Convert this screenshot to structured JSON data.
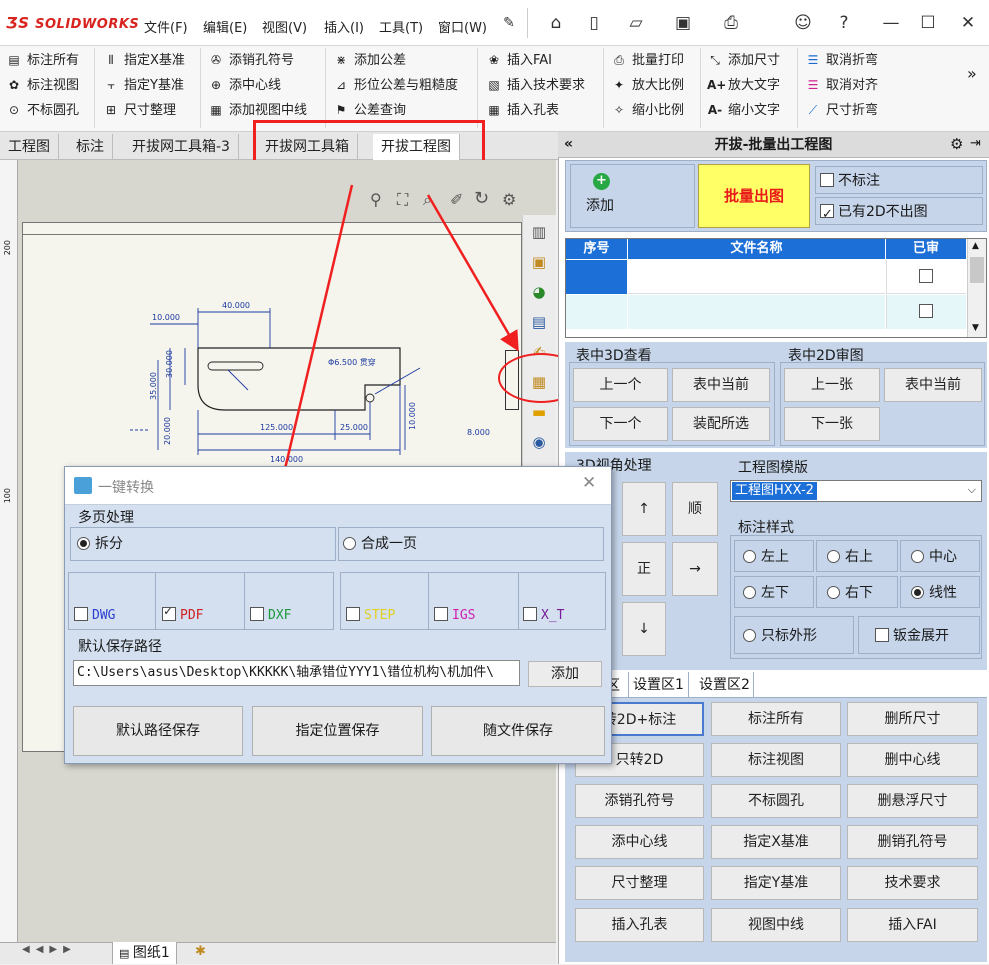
{
  "app": {
    "brand": "SOLIDWORKS"
  },
  "menu": [
    "文件(F)",
    "编辑(E)",
    "视图(V)",
    "插入(I)",
    "工具(T)",
    "窗口(W)"
  ],
  "ribbon": {
    "col1": [
      "标注所有",
      "标注视图",
      "不标圆孔"
    ],
    "col2": [
      "指定X基准",
      "指定Y基准",
      "尺寸整理"
    ],
    "col3": [
      "添销孔符号",
      "添中心线",
      "添加视图中线"
    ],
    "col4": [
      "添加公差",
      "形位公差与粗糙度",
      "公差查询"
    ],
    "col5": [
      "插入FAI",
      "插入技术要求",
      "插入孔表"
    ],
    "col6": [
      "批量打印",
      "放大比例",
      "缩小比例"
    ],
    "col7": [
      "添加尺寸",
      "放大文字",
      "缩小文字"
    ],
    "col8": [
      "取消折弯",
      "取消对齐",
      "尺寸折弯"
    ]
  },
  "tabs": [
    "工程图",
    "标注",
    "开拔网工具箱-3",
    "开拔网工具箱",
    "开拔工程图"
  ],
  "sheet_tab": "图纸1",
  "drawing": {
    "dims": [
      "40.000",
      "10.000",
      "35.000",
      "30.000",
      "20.000",
      "125.000",
      "25.000",
      "140.000",
      "Φ6.500 贯穿",
      "8.000",
      "10.000"
    ],
    "ruler": [
      "200",
      "100"
    ]
  },
  "panel": {
    "title": "开拔-批量出工程图",
    "add": "添加",
    "batch": "批量出图",
    "no_annotate": "不标注",
    "skip_2d": "已有2D不出图",
    "table_headers": [
      "序号",
      "文件名称",
      "已审"
    ],
    "view3d_title": "表中3D查看",
    "review2d_title": "表中2D审图",
    "prev": "上一个",
    "current": "表中当前",
    "next": "下一个",
    "assembly_sel": "装配所选",
    "prev_sheet": "上一张",
    "next_sheet": "下一张",
    "view_title": "3D视角处理",
    "arrows": [
      "↑",
      "顺",
      "正",
      "→",
      "↓"
    ],
    "template_title": "工程图模版",
    "template_value": "工程图HXX-2",
    "style_title": "标注样式",
    "styles": [
      "左上",
      "右上",
      "中心",
      "左下",
      "右下",
      "线性"
    ],
    "outline_only": "只标外形",
    "sheetmetal": "钣金展开",
    "area_tabs": [
      "区",
      "设置区1",
      "设置区2"
    ],
    "grid": [
      [
        "转2D+标注",
        "标注所有",
        "删所尺寸"
      ],
      [
        "只转2D",
        "标注视图",
        "删中心线"
      ],
      [
        "添销孔符号",
        "不标圆孔",
        "删悬浮尺寸"
      ],
      [
        "添中心线",
        "指定X基准",
        "删销孔符号"
      ],
      [
        "尺寸整理",
        "指定Y基准",
        "技术要求"
      ],
      [
        "插入孔表",
        "视图中线",
        "插入FAI"
      ]
    ]
  },
  "dialog": {
    "title": "一键转换",
    "multipage": "多页处理",
    "split": "拆分",
    "merge": "合成一页",
    "formats": [
      {
        "name": "DWG",
        "color": "#2a3fd0",
        "checked": false
      },
      {
        "name": "PDF",
        "color": "#d02020",
        "checked": true
      },
      {
        "name": "DXF",
        "color": "#1a9a3a",
        "checked": false
      },
      {
        "name": "STEP",
        "color": "#e0d020",
        "checked": false
      },
      {
        "name": "IGS",
        "color": "#d020b0",
        "checked": false
      },
      {
        "name": "X_T",
        "color": "#7a1a9a",
        "checked": false
      }
    ],
    "path_label": "默认保存路径",
    "path": "C:\\Users\\asus\\Desktop\\KKKKK\\轴承错位YYY1\\错位机构\\机加件\\",
    "add": "添加",
    "save_default": "默认路径保存",
    "save_specify": "指定位置保存",
    "save_with_file": "随文件保存"
  },
  "colors": {
    "accent_red": "#f02020",
    "panel_blue": "#c6d5ea",
    "batch_yellow": "#ffff66"
  }
}
